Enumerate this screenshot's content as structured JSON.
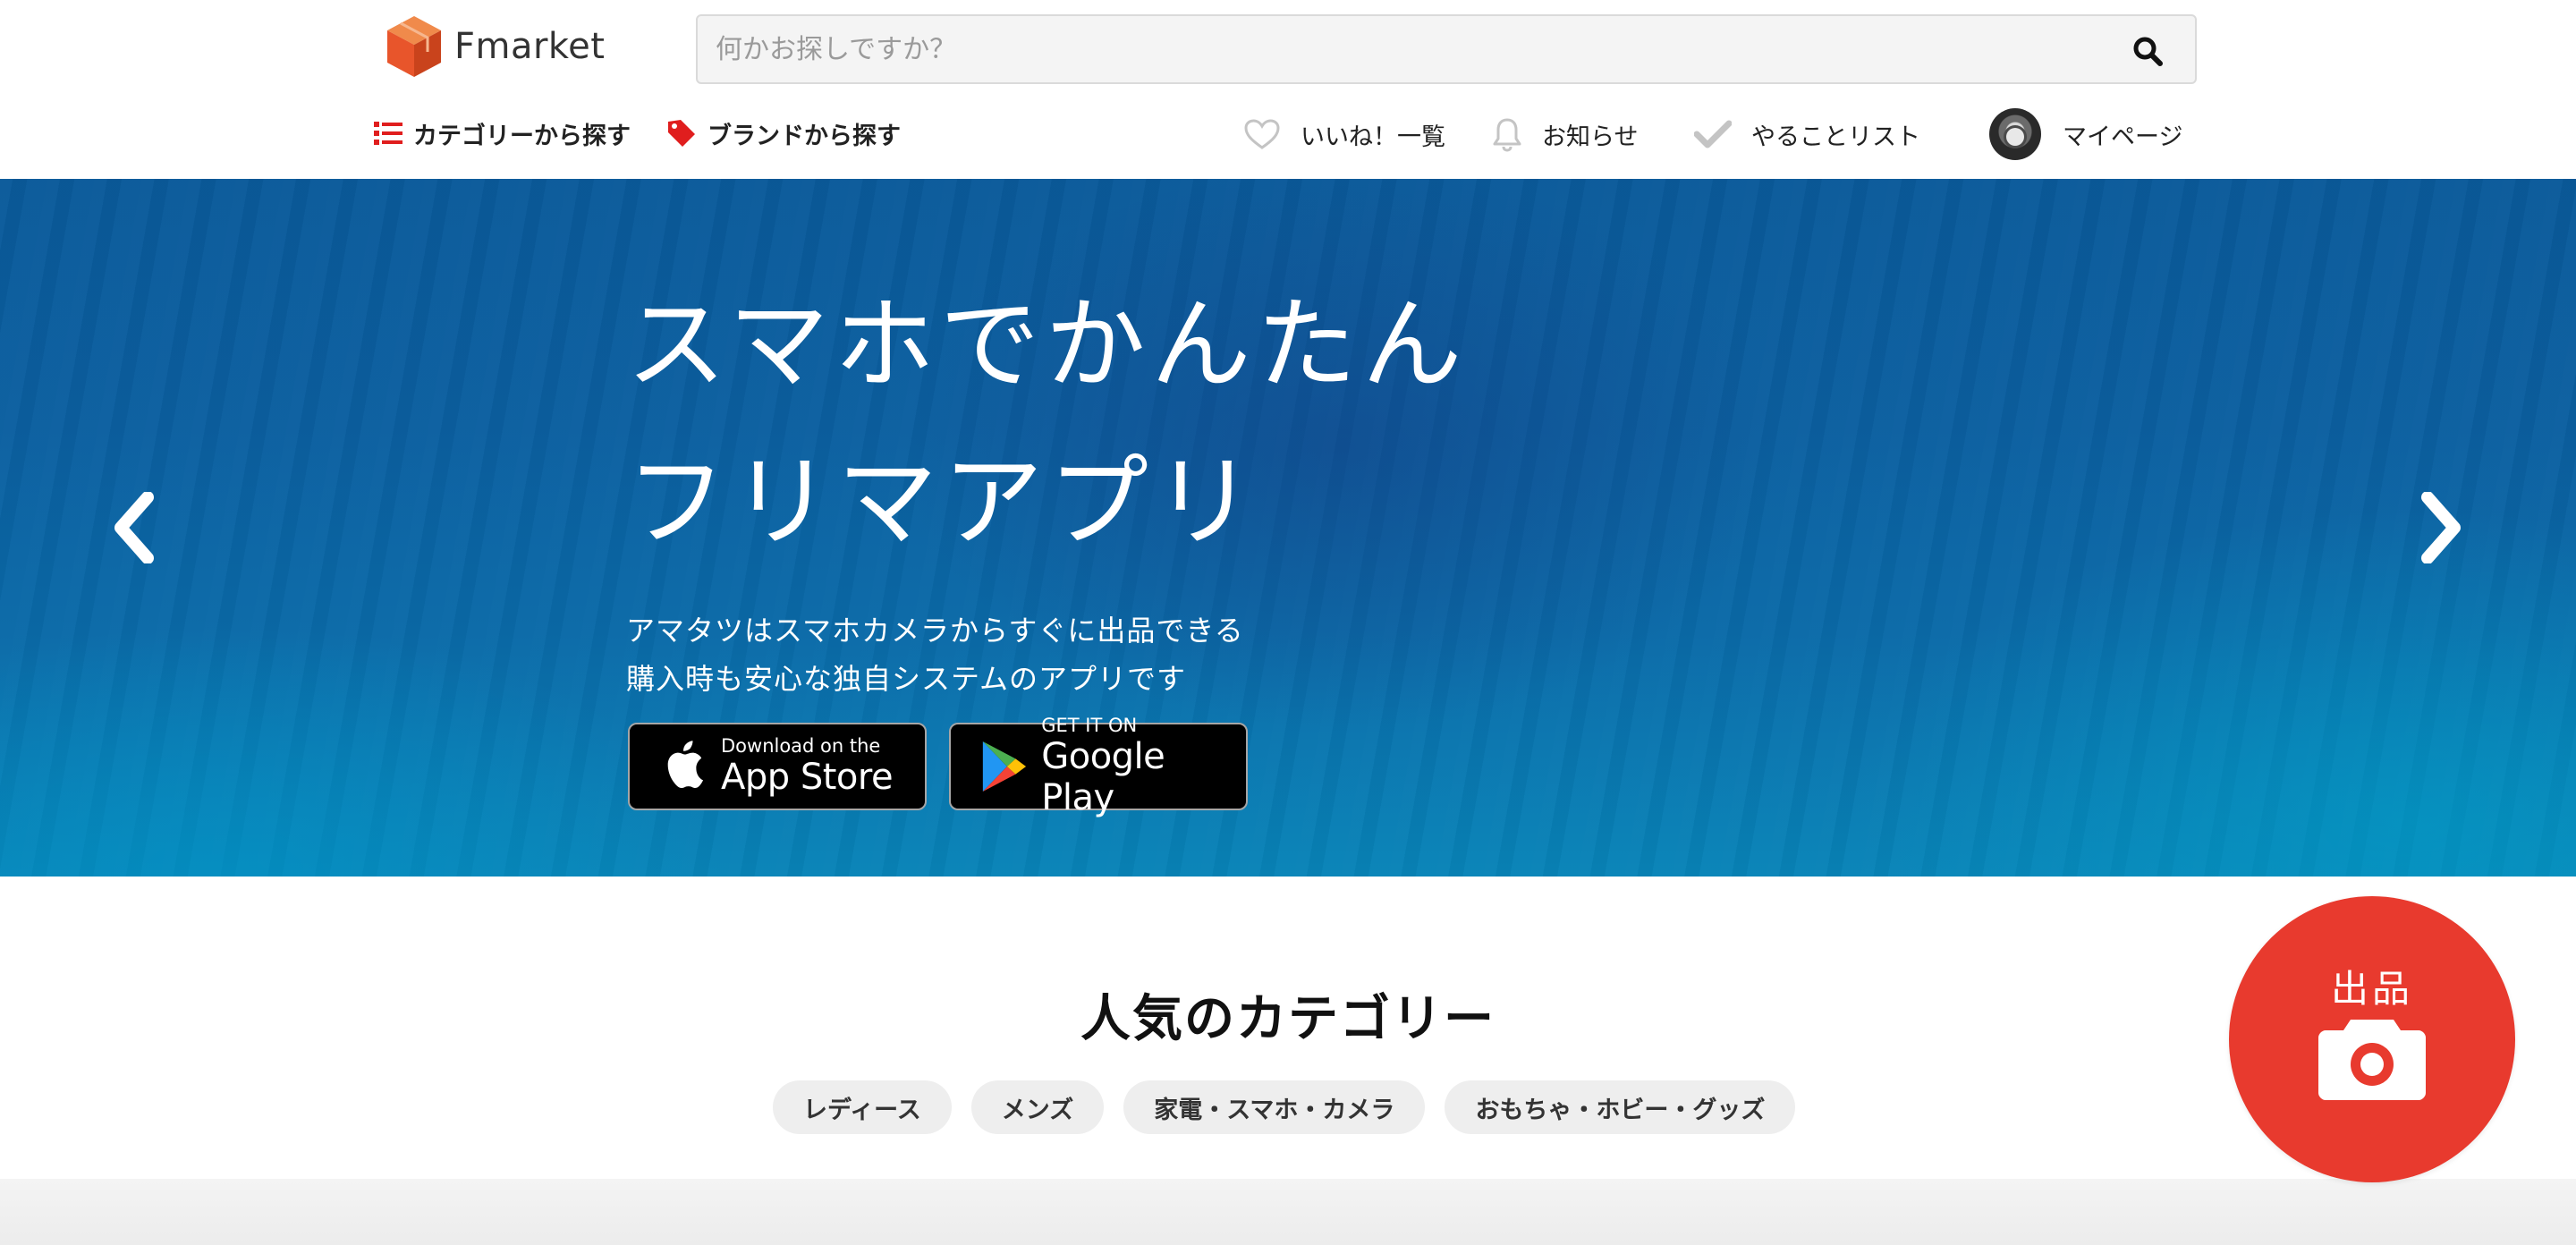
{
  "header": {
    "logo_text": "Fmarket",
    "search_placeholder": "何かお探しですか？",
    "nav_left": [
      {
        "label": "カテゴリーから探す",
        "icon": "list-icon"
      },
      {
        "label": "ブランドから探す",
        "icon": "tag-icon"
      }
    ],
    "nav_right": [
      {
        "label": "いいね！一覧",
        "icon": "heart-icon"
      },
      {
        "label": "お知らせ",
        "icon": "bell-icon"
      },
      {
        "label": "やることリスト",
        "icon": "check-icon"
      },
      {
        "label": "マイページ",
        "icon": "avatar"
      }
    ]
  },
  "hero": {
    "title_line1": "スマホでかんたん",
    "title_line2": "フリマアプリ",
    "subtitle_line1": "アマタツはスマホカメラからすぐに出品できる",
    "subtitle_line2": "購入時も安心な独自システムのアプリです",
    "app_store": {
      "small": "Download on the",
      "big": "App Store"
    },
    "google_play": {
      "small": "GET IT ON",
      "big": "Google Play"
    }
  },
  "popular": {
    "title": "人気のカテゴリー",
    "categories": [
      "レディース",
      "メンズ",
      "家電・スマホ・カメラ",
      "おもちゃ・ホビー・グッズ"
    ]
  },
  "sell_button": {
    "label": "出品",
    "icon": "camera-icon"
  },
  "colors": {
    "brand_orange": "#e8552b",
    "accent_red": "#e83a2e",
    "tag_red": "#e01e1e",
    "hero_blue": "#0b5fa0",
    "chip_bg": "#eeeeee"
  }
}
